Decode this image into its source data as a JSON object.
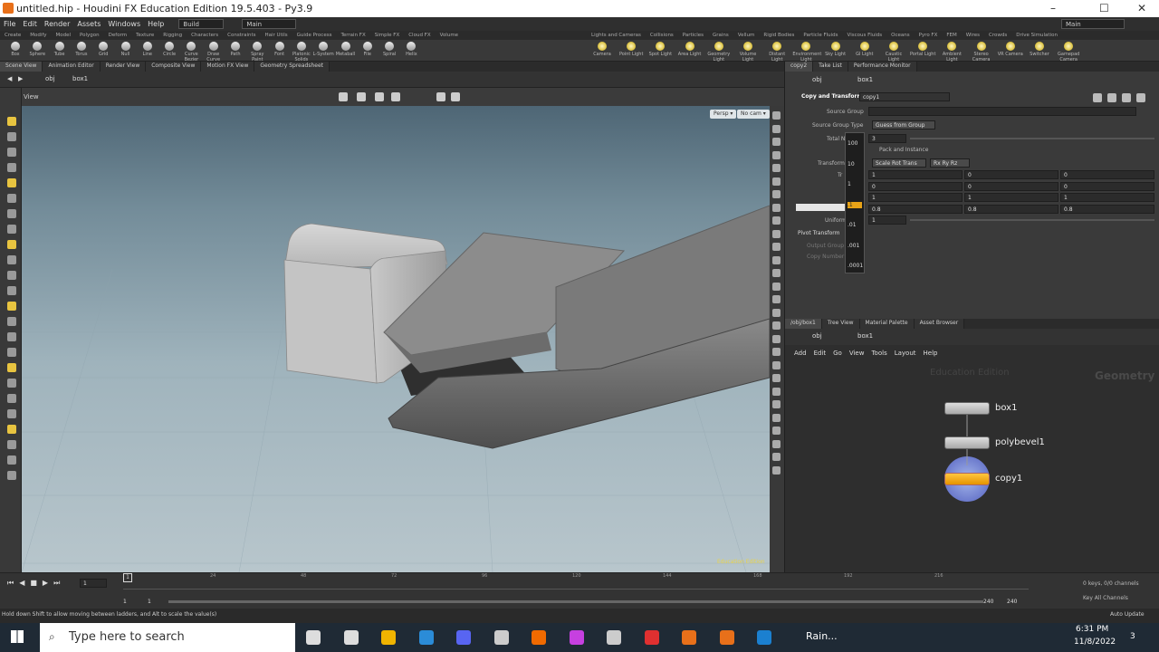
{
  "window": {
    "title": "untitled.hip - Houdini FX Education Edition 19.5.403 - Py3.9",
    "minimize": "–",
    "maximize": "☐",
    "close": "✕"
  },
  "menubar": {
    "items": [
      "File",
      "Edit",
      "Render",
      "Assets",
      "Windows",
      "Help"
    ],
    "build": "Build",
    "desktop": "Main",
    "desktop_right": "Main"
  },
  "shelf_tabs_left": [
    "Create",
    "Modify",
    "Model",
    "Polygon",
    "Deform",
    "Texture",
    "Rigging",
    "Characters",
    "Constraints",
    "Hair Utils",
    "Guide Process",
    "Terrain FX",
    "Simple FX",
    "Cloud FX",
    "Volume"
  ],
  "shelf_tabs_right": [
    "Lights and Cameras",
    "Collisions",
    "Particles",
    "Grains",
    "Vellum",
    "Rigid Bodies",
    "Particle Fluids",
    "Viscous Fluids",
    "Oceans",
    "Pyro FX",
    "FEM",
    "Wires",
    "Crowds",
    "Drive Simulation"
  ],
  "shelf_tools_left": [
    "Box",
    "Sphere",
    "Tube",
    "Torus",
    "Grid",
    "Null",
    "Line",
    "Circle",
    "Curve Bezier",
    "Draw Curve",
    "Path",
    "Spray Paint",
    "Font",
    "Platonic Solids",
    "L-System",
    "Metaball",
    "File",
    "Spiral",
    "Helix"
  ],
  "shelf_tools_right": [
    "Camera",
    "Point Light",
    "Spot Light",
    "Area Light",
    "Geometry Light",
    "Volume Light",
    "Distant Light",
    "Environment Light",
    "Sky Light",
    "GI Light",
    "Caustic Light",
    "Portal Light",
    "Ambient Light",
    "Stereo Camera",
    "VR Camera",
    "Switcher",
    "Gamepad Camera"
  ],
  "pane_tabs": [
    "Scene View",
    "Animation Editor",
    "Render View",
    "Composite View",
    "Motion FX View",
    "Geometry Spreadsheet"
  ],
  "viewer": {
    "path_obj": "obj",
    "path_node": "box1",
    "view_label": "View",
    "persp": "Persp ▾",
    "cam": "No cam ▾",
    "watermark": "Education Edition"
  },
  "param_tabs": [
    "copy2",
    "Take List",
    "Performance Monitor"
  ],
  "params": {
    "path_obj": "obj",
    "path_node": "box1",
    "node_type": "Copy and Transform",
    "node_name": "copy1",
    "source_group_label": "Source Group",
    "source_group_type_label": "Source Group Type",
    "source_group_type": "Guess from Group",
    "total_label": "Total N",
    "total_value": "3",
    "pack_label": "Pack and Instance",
    "transform_order_label": "Transform",
    "transform_order": "Scale Rot Trans",
    "rot_order": "Rx Ry Rz",
    "translate_label": "Tr",
    "rows": [
      [
        "1",
        "0",
        "0"
      ],
      [
        "0",
        "0",
        "0"
      ],
      [
        "1",
        "1",
        "1"
      ],
      [
        "0.8",
        "0.8",
        "0.8"
      ]
    ],
    "uniform_label": "Uniform",
    "uniform_value": "1",
    "pivot_label": "Pivot Transform",
    "output_group_label": "Output Group",
    "copy_number_label": "Copy Number",
    "ladder": [
      "100",
      "10",
      "1",
      ".1",
      ".01",
      ".001",
      ".0001"
    ]
  },
  "network_tabs": [
    "/obj/box1",
    "Tree View",
    "Material Palette",
    "Asset Browser"
  ],
  "network": {
    "path_obj": "obj",
    "path_node": "box1",
    "menu": [
      "Add",
      "Edit",
      "Go",
      "View",
      "Tools",
      "Layout",
      "Help"
    ],
    "watermark": "Education Edition",
    "context": "Geometry",
    "nodes": [
      {
        "name": "box1"
      },
      {
        "name": "polybevel1"
      },
      {
        "name": "copy1"
      }
    ]
  },
  "timeline": {
    "frame": "1",
    "ticks": [
      "24",
      "48",
      "72",
      "96",
      "120",
      "144",
      "168",
      "192",
      "216"
    ],
    "start": "1",
    "start2": "1",
    "end": "240",
    "end2": "240",
    "keys": "0 keys, 0/0 channels",
    "key_all": "Key All Channels",
    "auto_update": "Auto Update"
  },
  "status_text": "Hold down Shift to allow moving between ladders, and Alt to scale the value(s)",
  "taskbar": {
    "search_placeholder": "Type here to search",
    "weather": "Rain...",
    "time": "6:31 PM",
    "date": "11/8/2022",
    "notif": "3"
  },
  "colors": {
    "accent": "#e8a317",
    "node_selected": "#f0a800"
  }
}
